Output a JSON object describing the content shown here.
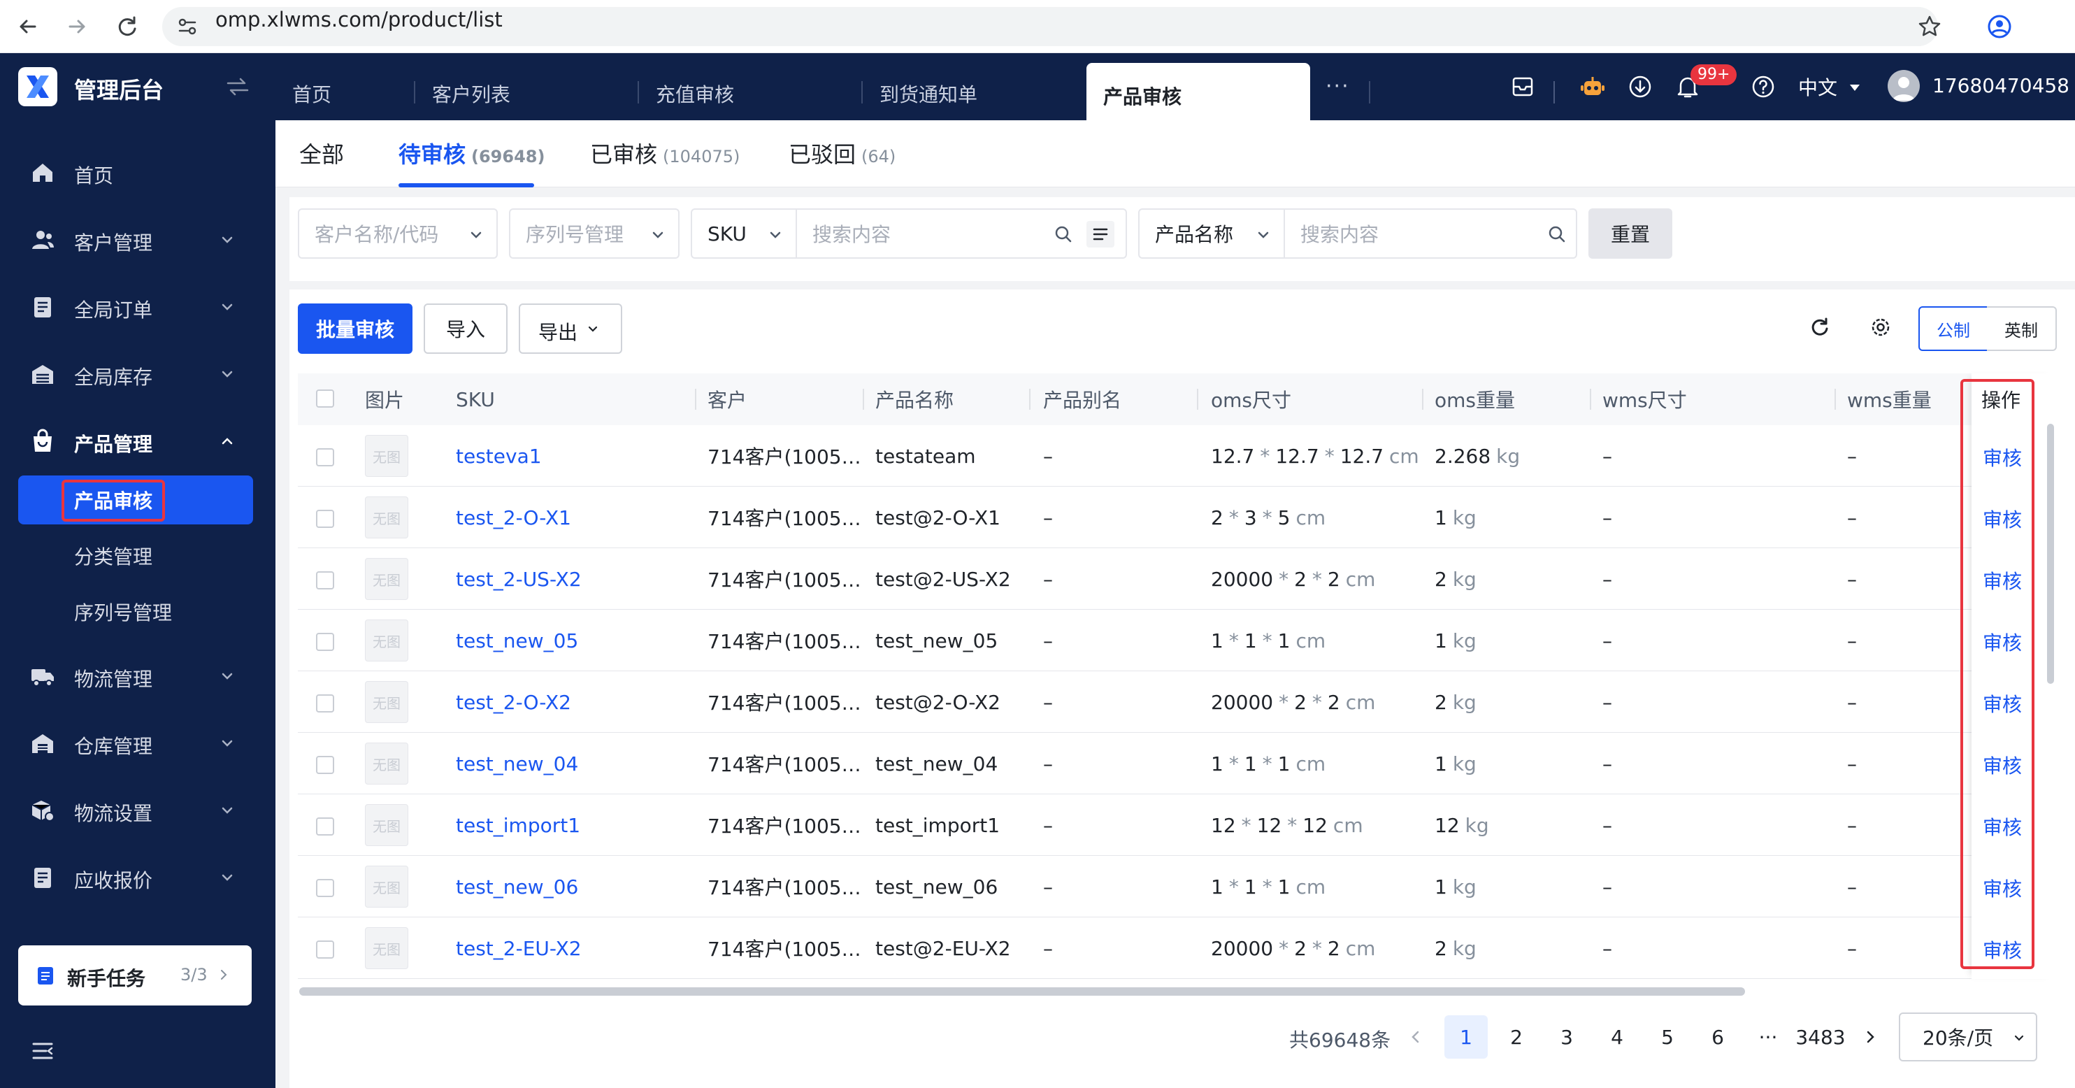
{
  "browser": {
    "url": "omp.xlwms.com/product/list"
  },
  "app": {
    "title": "管理后台"
  },
  "top_tabs": [
    {
      "label": "首页"
    },
    {
      "label": "客户列表"
    },
    {
      "label": "充值审核"
    },
    {
      "label": "到货通知单"
    },
    {
      "label": "产品审核",
      "active": true
    }
  ],
  "header": {
    "more": "···",
    "notification_badge": "99+",
    "language": "中文",
    "user": "17680470458"
  },
  "sidebar": {
    "items": [
      {
        "label": "首页",
        "icon": "home-icon"
      },
      {
        "label": "客户管理",
        "icon": "customer-icon"
      },
      {
        "label": "全局订单",
        "icon": "order-icon"
      },
      {
        "label": "全局库存",
        "icon": "inventory-icon"
      },
      {
        "label": "产品管理",
        "icon": "product-icon",
        "expanded": true
      },
      {
        "label": "物流管理",
        "icon": "truck-icon"
      },
      {
        "label": "仓库管理",
        "icon": "warehouse-icon"
      },
      {
        "label": "物流设置",
        "icon": "box-settings-icon"
      },
      {
        "label": "应收报价",
        "icon": "quote-icon"
      }
    ],
    "sub_items": [
      {
        "label": "产品审核",
        "active": true
      },
      {
        "label": "分类管理"
      },
      {
        "label": "序列号管理"
      }
    ],
    "new_task": {
      "label": "新手任务",
      "progress": "3/3"
    }
  },
  "status_tabs": [
    {
      "label": "全部",
      "count": ""
    },
    {
      "label": "待审核",
      "count": "(69648)",
      "active": true
    },
    {
      "label": "已审核",
      "count": "(104075)"
    },
    {
      "label": "已驳回",
      "count": "(64)"
    }
  ],
  "filters": {
    "customer_placeholder": "客户名称/代码",
    "serial_placeholder": "序列号管理",
    "sku_field": "SKU",
    "search_placeholder": "搜索内容",
    "product_field": "产品名称",
    "search2_placeholder": "搜索内容",
    "reset_label": "重置"
  },
  "toolbar": {
    "batch_review": "批量审核",
    "import": "导入",
    "export": "导出",
    "unit_metric": "公制",
    "unit_imperial": "英制"
  },
  "table": {
    "columns": [
      "图片",
      "SKU",
      "客户",
      "产品名称",
      "产品别名",
      "oms尺寸",
      "oms重量",
      "wms尺寸",
      "wms重量",
      "操作"
    ],
    "no_image": "无图",
    "rows": [
      {
        "sku": "testeva1",
        "customer": "714客户(1005…",
        "name": "testateam",
        "alias": "–",
        "dims": [
          "12.7",
          "12.7",
          "12.7"
        ],
        "dim_unit": "cm",
        "weight": "2.268",
        "weight_unit": "kg",
        "wms_size": "–",
        "wms_weight": "–",
        "action": "审核"
      },
      {
        "sku": "test_2-O-X1",
        "customer": "714客户(1005…",
        "name": "test@2-O-X1",
        "alias": "–",
        "dims": [
          "2",
          "3",
          "5"
        ],
        "dim_unit": "cm",
        "weight": "1",
        "weight_unit": "kg",
        "wms_size": "–",
        "wms_weight": "–",
        "action": "审核"
      },
      {
        "sku": "test_2-US-X2",
        "customer": "714客户(1005…",
        "name": "test@2-US-X2",
        "alias": "–",
        "dims": [
          "20000",
          "2",
          "2"
        ],
        "dim_unit": "cm",
        "weight": "2",
        "weight_unit": "kg",
        "wms_size": "–",
        "wms_weight": "–",
        "action": "审核"
      },
      {
        "sku": "test_new_05",
        "customer": "714客户(1005…",
        "name": "test_new_05",
        "alias": "–",
        "dims": [
          "1",
          "1",
          "1"
        ],
        "dim_unit": "cm",
        "weight": "1",
        "weight_unit": "kg",
        "wms_size": "–",
        "wms_weight": "–",
        "action": "审核"
      },
      {
        "sku": "test_2-O-X2",
        "customer": "714客户(1005…",
        "name": "test@2-O-X2",
        "alias": "–",
        "dims": [
          "20000",
          "2",
          "2"
        ],
        "dim_unit": "cm",
        "weight": "2",
        "weight_unit": "kg",
        "wms_size": "–",
        "wms_weight": "–",
        "action": "审核"
      },
      {
        "sku": "test_new_04",
        "customer": "714客户(1005…",
        "name": "test_new_04",
        "alias": "–",
        "dims": [
          "1",
          "1",
          "1"
        ],
        "dim_unit": "cm",
        "weight": "1",
        "weight_unit": "kg",
        "wms_size": "–",
        "wms_weight": "–",
        "action": "审核"
      },
      {
        "sku": "test_import1",
        "customer": "714客户(1005…",
        "name": "test_import1",
        "alias": "–",
        "dims": [
          "12",
          "12",
          "12"
        ],
        "dim_unit": "cm",
        "weight": "12",
        "weight_unit": "kg",
        "wms_size": "–",
        "wms_weight": "–",
        "action": "审核"
      },
      {
        "sku": "test_new_06",
        "customer": "714客户(1005…",
        "name": "test_new_06",
        "alias": "–",
        "dims": [
          "1",
          "1",
          "1"
        ],
        "dim_unit": "cm",
        "weight": "1",
        "weight_unit": "kg",
        "wms_size": "–",
        "wms_weight": "–",
        "action": "审核"
      },
      {
        "sku": "test_2-EU-X2",
        "customer": "714客户(1005…",
        "name": "test@2-EU-X2",
        "alias": "–",
        "dims": [
          "20000",
          "2",
          "2"
        ],
        "dim_unit": "cm",
        "weight": "2",
        "weight_unit": "kg",
        "wms_size": "–",
        "wms_weight": "–",
        "action": "审核"
      }
    ]
  },
  "pagination": {
    "total": "共69648条",
    "pages": [
      "1",
      "2",
      "3",
      "4",
      "5",
      "6"
    ],
    "ellipsis": "···",
    "last": "3483",
    "current": "1",
    "page_size": "20条/页"
  },
  "colors": {
    "primary": "#1a56f0",
    "nav_bg": "#0f2149",
    "highlight": "#e8353f"
  }
}
